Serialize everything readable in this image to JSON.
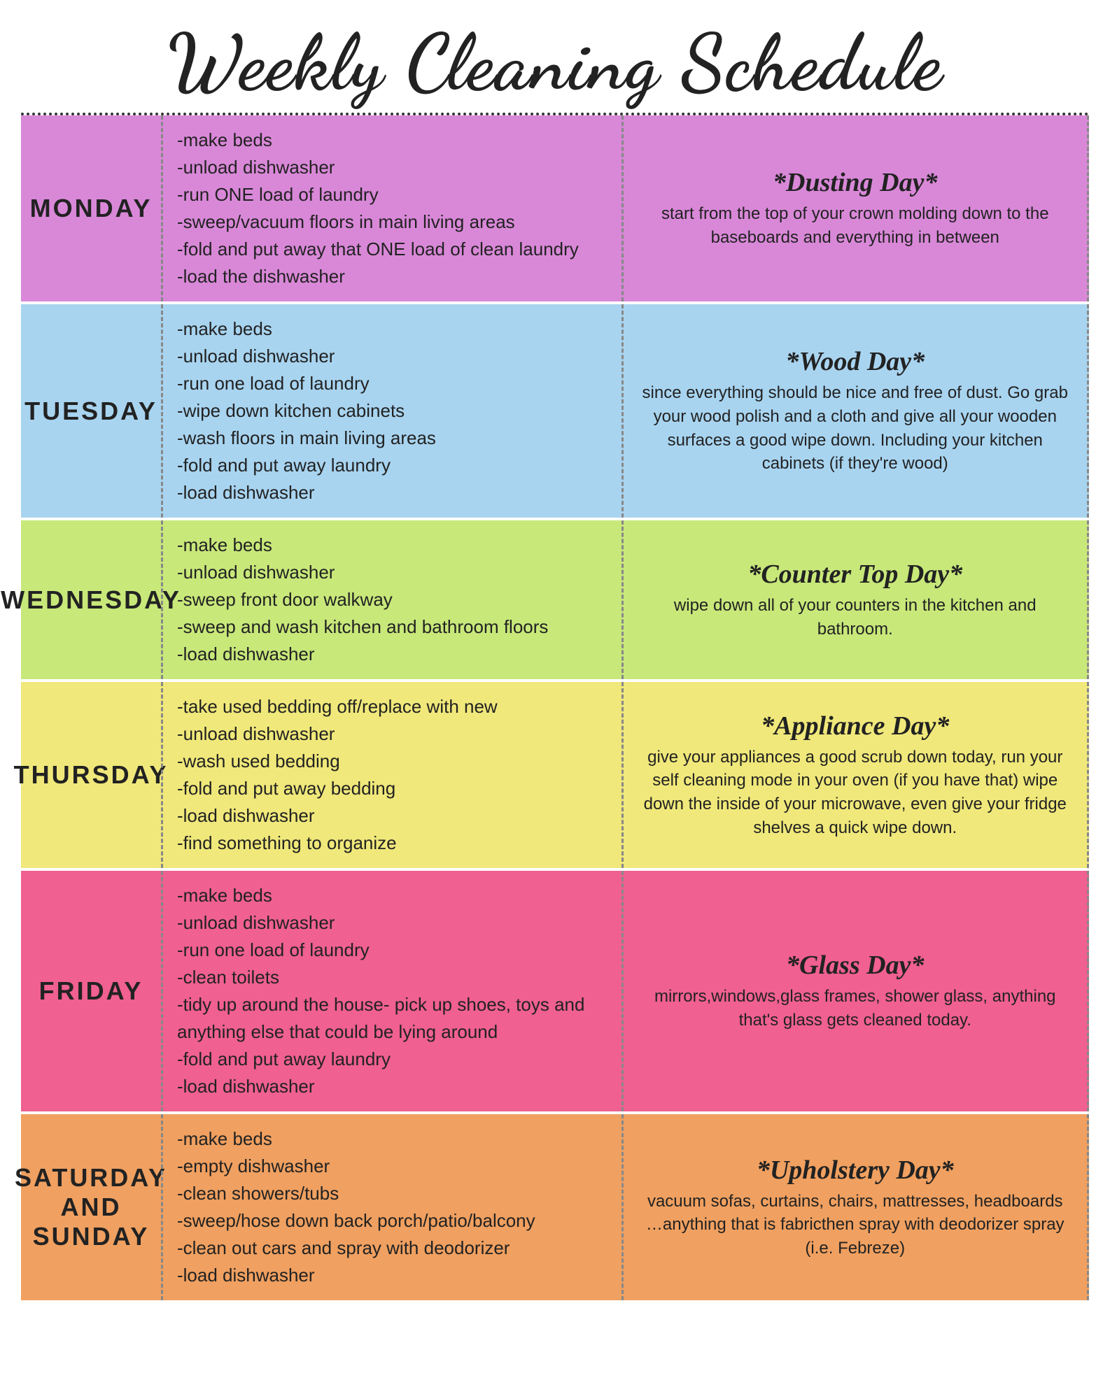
{
  "title": "Weekly Cleaning Schedule",
  "days": [
    {
      "id": "monday",
      "label": "MONDAY",
      "color": "#d988d8",
      "tasks": [
        "-make beds",
        "-unload dishwasher",
        "-run ONE load of laundry",
        "-sweep/vacuum floors in main living areas",
        "-fold and put away that ONE load of clean laundry",
        "-load the dishwasher"
      ],
      "special_title": "*Dusting Day*",
      "special_desc": "start from the top of your crown molding down to the baseboards and everything in between"
    },
    {
      "id": "tuesday",
      "label": "TUESDAY",
      "color": "#a8d4f0",
      "tasks": [
        "-make beds",
        "-unload dishwasher",
        "-run one load of laundry",
        "-wipe down kitchen cabinets",
        "-wash floors in main living areas",
        "-fold and put away laundry",
        "-load dishwasher"
      ],
      "special_title": "*Wood Day*",
      "special_desc": "since everything should be nice and free of dust. Go grab your wood polish and a cloth and give all your wooden surfaces a good wipe down. Including your kitchen cabinets (if they're wood)"
    },
    {
      "id": "wednesday",
      "label": "WEDNESDAY",
      "color": "#c8e87a",
      "tasks": [
        "-make beds",
        "-unload dishwasher",
        "-sweep front door walkway",
        "-sweep and wash kitchen and bathroom floors",
        "-load dishwasher"
      ],
      "special_title": "*Counter Top Day*",
      "special_desc": "wipe down all of your counters in the kitchen and bathroom."
    },
    {
      "id": "thursday",
      "label": "THURSDAY",
      "color": "#f0e87a",
      "tasks": [
        "-take used bedding off/replace with new",
        "-unload dishwasher",
        "-wash used bedding",
        "-fold and put away bedding",
        "-load dishwasher",
        "-find something to organize"
      ],
      "special_title": "*Appliance Day*",
      "special_desc": "give your appliances a good scrub down today, run your self cleaning mode in your oven (if you have that) wipe down the inside of your microwave, even give your fridge shelves a quick wipe down."
    },
    {
      "id": "friday",
      "label": "FRIDAY",
      "color": "#f06090",
      "tasks": [
        "-make beds",
        "-unload dishwasher",
        "-run one load of laundry",
        "-clean toilets",
        "-tidy up around the house- pick up shoes, toys and anything else that could be lying around",
        "-fold and put away laundry",
        "-load dishwasher"
      ],
      "special_title": "*Glass Day*",
      "special_desc": "mirrors,windows,glass frames, shower glass, anything that's glass gets cleaned today."
    },
    {
      "id": "saturday",
      "label": "SATURDAY AND SUNDAY",
      "color": "#f0a060",
      "tasks": [
        "-make beds",
        "-empty dishwasher",
        "-clean showers/tubs",
        "-sweep/hose down back porch/patio/balcony",
        "-clean out cars and spray with deodorizer",
        "-load dishwasher"
      ],
      "special_title": "*Upholstery Day*",
      "special_desc": "vacuum sofas, curtains, chairs, mattresses, headboards …anything that is fabricthen spray with deodorizer spray (i.e. Febreze)"
    }
  ]
}
